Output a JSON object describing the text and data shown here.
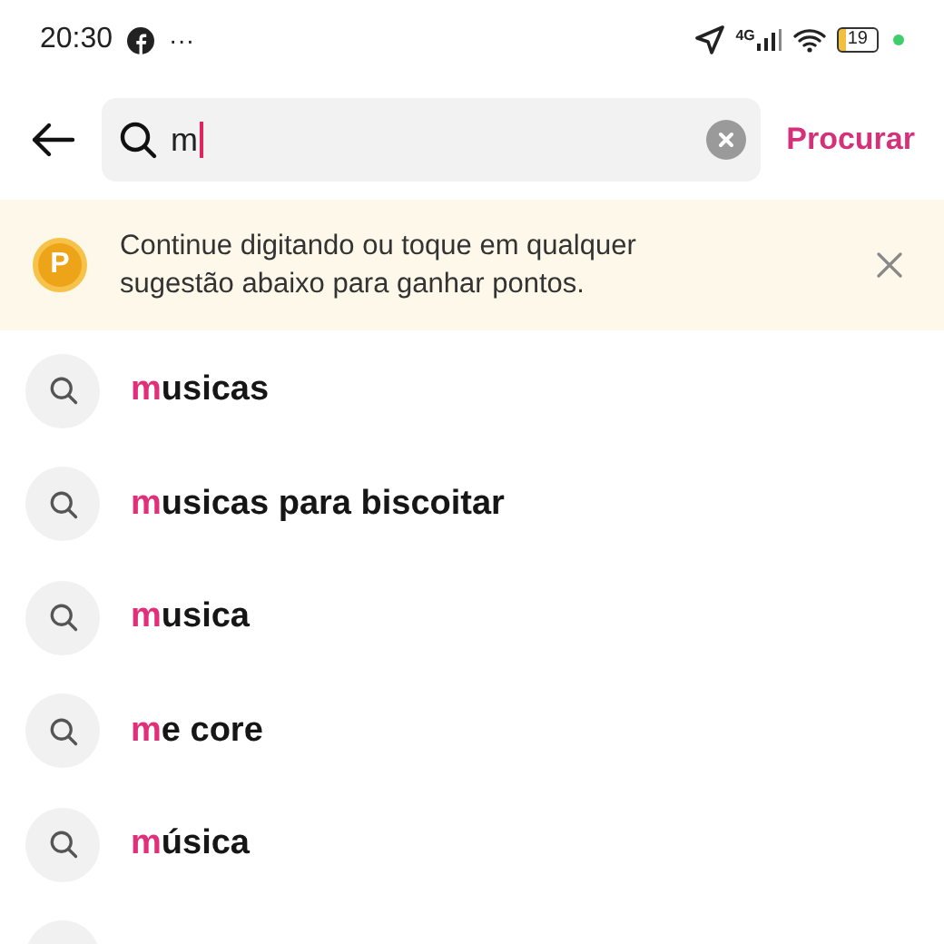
{
  "status_bar": {
    "time": "20:30",
    "more": "···",
    "network": "4G",
    "battery": "19"
  },
  "search": {
    "value": "m",
    "action": "Procurar"
  },
  "banner": {
    "text": "Continue digitando ou toque em qualquer sugestão abaixo para ganhar pontos.",
    "badge": "P"
  },
  "suggestions": [
    {
      "match": "m",
      "rest": "usicas"
    },
    {
      "match": "m",
      "rest": "usicas para biscoitar"
    },
    {
      "match": "m",
      "rest": "usica"
    },
    {
      "match": "m",
      "rest": "e core"
    },
    {
      "match": "m",
      "rest": "úsica"
    }
  ]
}
